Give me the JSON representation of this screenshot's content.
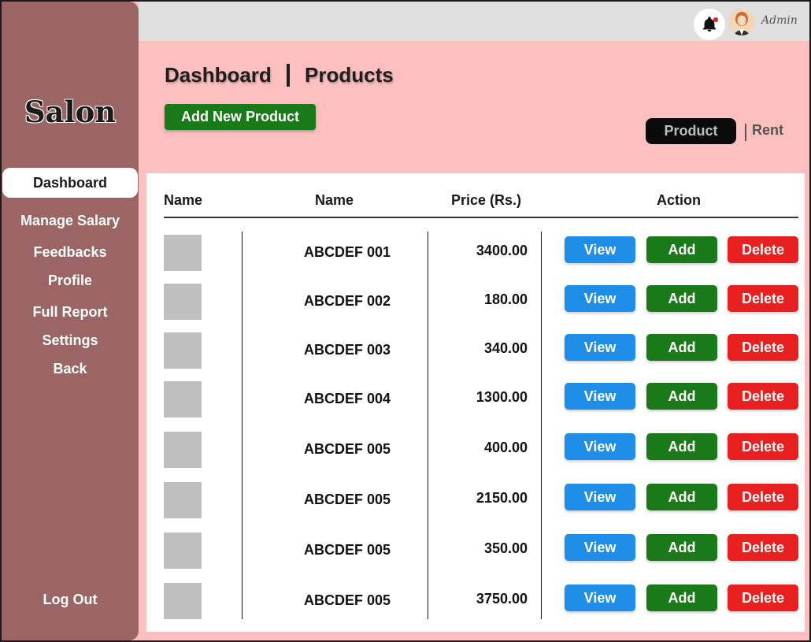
{
  "topbar": {
    "user_name": "Admin",
    "notification_icon": "bell-icon",
    "avatar_icon": "user-avatar-icon"
  },
  "sidebar": {
    "logo": "Salon",
    "items": [
      {
        "label": "Dashboard",
        "active": true
      },
      {
        "label": "Manage Salary"
      },
      {
        "label": "Feedbacks"
      },
      {
        "label": "Profile"
      },
      {
        "label": "Full Report"
      },
      {
        "label": "Settings"
      },
      {
        "label": "Back"
      }
    ],
    "logout": "Log Out"
  },
  "header": {
    "crumb_root": "Dashboard",
    "crumb_page": "Products",
    "add_button": "Add New Product",
    "toggle": {
      "active": "Product",
      "other": "Rent"
    }
  },
  "table": {
    "headers": [
      "Name",
      "Name",
      "Price (Rs.)",
      "Action"
    ],
    "actions": {
      "view": "View",
      "add": "Add",
      "delete": "Delete"
    },
    "rows": [
      {
        "name": "ABCDEF 001",
        "price": "3400.00"
      },
      {
        "name": "ABCDEF 002",
        "price": "180.00"
      },
      {
        "name": "ABCDEF 003",
        "price": "340.00"
      },
      {
        "name": "ABCDEF 004",
        "price": "1300.00"
      },
      {
        "name": "ABCDEF 005",
        "price": "400.00"
      },
      {
        "name": "ABCDEF 005",
        "price": "2150.00"
      },
      {
        "name": "ABCDEF 005",
        "price": "350.00"
      },
      {
        "name": "ABCDEF 005",
        "price": "3750.00"
      }
    ]
  },
  "colors": {
    "sidebar": "#9b6565",
    "background": "#fdbfbf",
    "view": "#1e8ee8",
    "add": "#1a7a1a",
    "delete": "#e82020"
  }
}
